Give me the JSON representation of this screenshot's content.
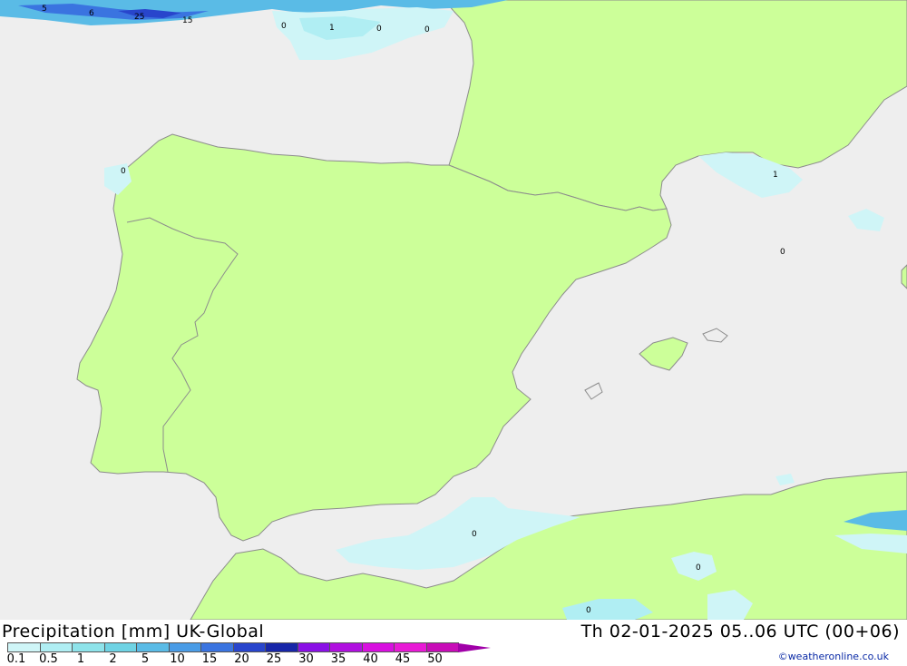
{
  "title": "Precipitation [mm] UK-Global",
  "timestamp": "Th 02-01-2025 05..06 UTC (00+06)",
  "credit": "©weatheronline.co.uk",
  "colors": {
    "sea": "#eeeeee",
    "land": "#ccff99",
    "coast": "#8c8c8c"
  },
  "legend": {
    "labels": [
      "0.1",
      "0.5",
      "1",
      "2",
      "5",
      "10",
      "15",
      "20",
      "25",
      "30",
      "35",
      "40",
      "45",
      "50"
    ],
    "colors": [
      "#cff5f7",
      "#b0eef3",
      "#8ee3ea",
      "#6fd3e4",
      "#5abbe6",
      "#4a9ce6",
      "#3a74e0",
      "#2845cc",
      "#1726a8",
      "#8a10e6",
      "#b010e0",
      "#d810e0",
      "#e81ad6",
      "#c80cb8"
    ]
  },
  "map_labels": [
    "5",
    "6",
    "25",
    "15",
    "0",
    "1",
    "0",
    "0",
    "0",
    "1",
    "0",
    "0",
    "0",
    "0"
  ]
}
